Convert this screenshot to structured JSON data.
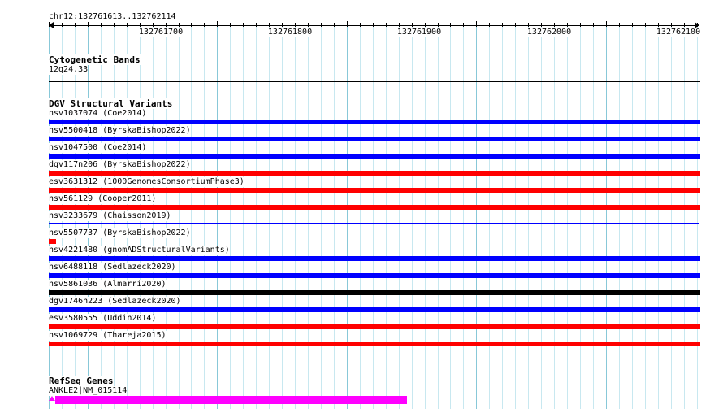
{
  "header": {
    "region": "chr12:132761613..132762114"
  },
  "ruler": {
    "ticks": [
      {
        "label": "132761700"
      },
      {
        "label": "132761800"
      },
      {
        "label": "132761900"
      },
      {
        "label": "132762000"
      },
      {
        "label": "132762100"
      }
    ]
  },
  "cytoband": {
    "title": "Cytogenetic Bands",
    "band": "12q24.33"
  },
  "dgv": {
    "title": "DGV Structural Variants",
    "items": [
      {
        "label": "nsv1037074 (Coe2014)",
        "color": "#0000ff"
      },
      {
        "label": "nsv5500418 (ByrskaBishop2022)",
        "color": "#0000ff"
      },
      {
        "label": "nsv1047500 (Coe2014)",
        "color": "#0000ff"
      },
      {
        "label": "dgv117n206 (ByrskaBishop2022)",
        "color": "#ff0000"
      },
      {
        "label": "esv3631312 (1000GenomesConsortiumPhase3)",
        "color": "#ff0000"
      },
      {
        "label": "nsv561129 (Cooper2011)",
        "color": "#ff0000"
      },
      {
        "label": "nsv3233679 (Chaisson2019)",
        "color": "#0000ff"
      },
      {
        "label": "nsv5507737 (ByrskaBishop2022)",
        "color": "#ff0000"
      },
      {
        "label": "nsv4221480 (gnomADStructuralVariants)",
        "color": "#0000ff"
      },
      {
        "label": "nsv6488118 (Sedlazeck2020)",
        "color": "#0000ff"
      },
      {
        "label": "nsv5861036 (Almarri2020)",
        "color": "#000000"
      },
      {
        "label": "dgv1746n223 (Sedlazeck2020)",
        "color": "#0000ff"
      },
      {
        "label": "esv3580555 (Uddin2014)",
        "color": "#ff0000"
      },
      {
        "label": "nsv1069729 (Thareja2015)",
        "color": "#ff0000"
      }
    ]
  },
  "refseq": {
    "title": "RefSeq Genes",
    "gene": "ANKLE2|NM_015114",
    "color": "#ff00ff"
  },
  "colors": {
    "grid_major": "#88c8d8",
    "grid_minor": "#c8e8f0"
  }
}
